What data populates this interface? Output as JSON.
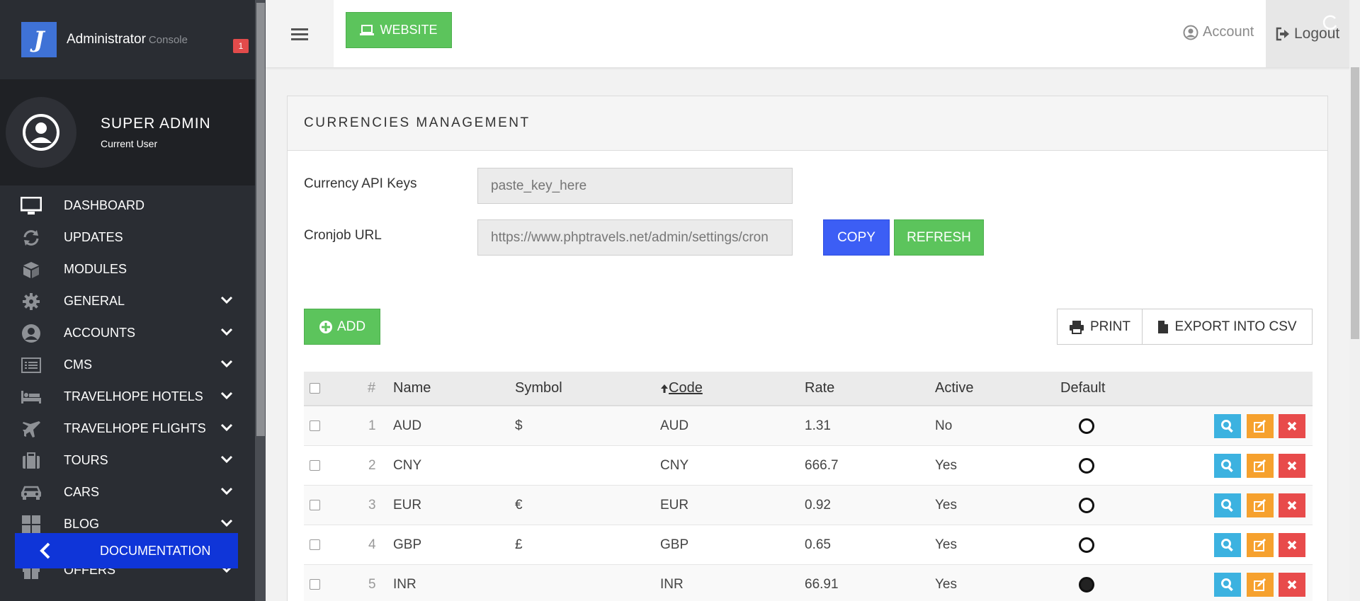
{
  "brand": {
    "title": "Administrator",
    "subtitle": "Console",
    "logo_letter": "J"
  },
  "user": {
    "name": "SUPER ADMIN",
    "role": "Current User"
  },
  "sidebar": {
    "items": [
      {
        "label": "DASHBOARD",
        "icon": "monitor-icon"
      },
      {
        "label": "UPDATES",
        "icon": "refresh-icon",
        "badge": "1"
      },
      {
        "label": "MODULES",
        "icon": "cube-icon"
      },
      {
        "label": "GENERAL",
        "icon": "gear-icon"
      },
      {
        "label": "ACCOUNTS",
        "icon": "user-circle-icon"
      },
      {
        "label": "CMS",
        "icon": "list-icon"
      },
      {
        "label": "TRAVELHOPE HOTELS",
        "icon": "bed-icon"
      },
      {
        "label": "TRAVELHOPE FLIGHTS",
        "icon": "plane-icon"
      },
      {
        "label": "TOURS",
        "icon": "suitcase-icon"
      },
      {
        "label": "CARS",
        "icon": "car-icon"
      },
      {
        "label": "BLOG",
        "icon": "grid-icon"
      },
      {
        "label": "OFFERS",
        "icon": "gift-icon"
      }
    ],
    "documentation": "DOCUMENTATION"
  },
  "topbar": {
    "website": "WEBSITE",
    "account": "Account",
    "logout": "Logout"
  },
  "panel": {
    "title": "CURRENCIES MANAGEMENT",
    "api_label": "Currency API Keys",
    "api_placeholder": "paste_key_here",
    "cron_label": "Cronjob URL",
    "cron_value": "https://www.phptravels.net/admin/settings/cron",
    "copy": "COPY",
    "refresh": "REFRESH",
    "add": "ADD",
    "print": "PRINT",
    "export": "EXPORT INTO CSV"
  },
  "table": {
    "headers": {
      "num": "#",
      "name": "Name",
      "symbol": "Symbol",
      "code": "Code",
      "rate": "Rate",
      "active": "Active",
      "default": "Default"
    },
    "rows": [
      {
        "num": "1",
        "name": "AUD",
        "symbol": "$",
        "code": "AUD",
        "rate": "1.31",
        "active": "No",
        "default": false
      },
      {
        "num": "2",
        "name": "CNY",
        "symbol": "",
        "code": "CNY",
        "rate": "666.7",
        "active": "Yes",
        "default": false
      },
      {
        "num": "3",
        "name": "EUR",
        "symbol": "€",
        "code": "EUR",
        "rate": "0.92",
        "active": "Yes",
        "default": false
      },
      {
        "num": "4",
        "name": "GBP",
        "symbol": "£",
        "code": "GBP",
        "rate": "0.65",
        "active": "Yes",
        "default": false
      },
      {
        "num": "5",
        "name": "INR",
        "symbol": "",
        "code": "INR",
        "rate": "66.91",
        "active": "Yes",
        "default": true
      }
    ]
  },
  "colors": {
    "sidebar": "#2a2d33",
    "green": "#5cc45c",
    "blue": "#3c5ef5",
    "doc_blue": "#0f35d8",
    "badge": "#e24b4b"
  }
}
